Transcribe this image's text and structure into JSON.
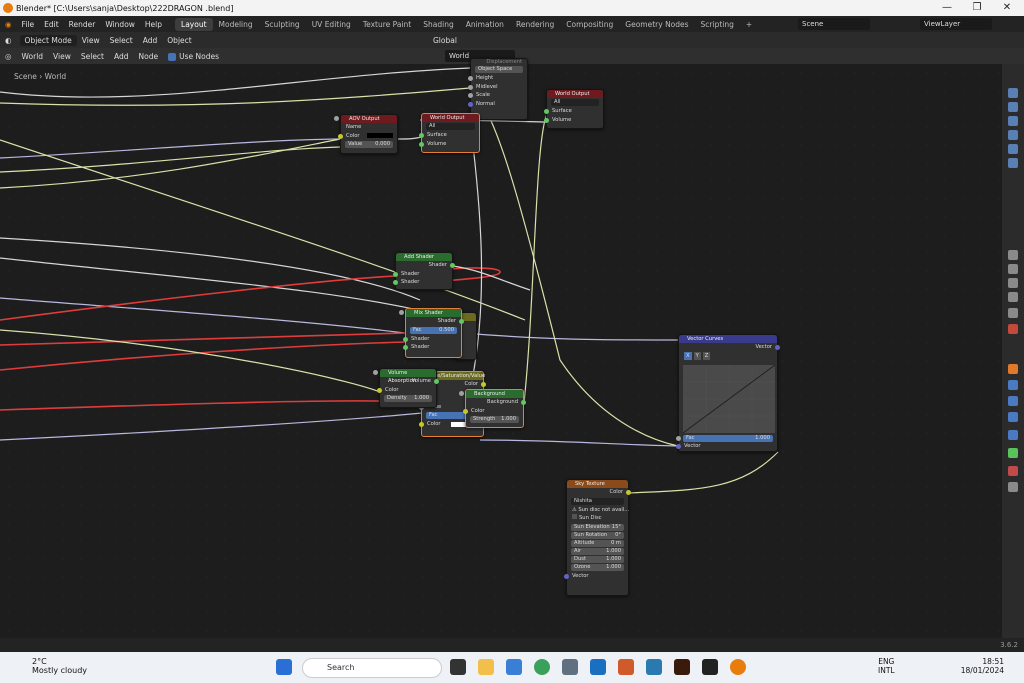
{
  "window": {
    "title": "Blender* [C:\\Users\\sanja\\Desktop\\222DRAGON .blend]",
    "minimize": "—",
    "maximize": "❐",
    "close": "✕"
  },
  "topbar": {
    "menus": [
      "File",
      "Edit",
      "Render",
      "Window",
      "Help"
    ],
    "workspaces": [
      "Layout",
      "Modeling",
      "Sculpting",
      "UV Editing",
      "Texture Paint",
      "Shading",
      "Animation",
      "Rendering",
      "Compositing",
      "Geometry Nodes",
      "Scripting"
    ],
    "add_tab": "+",
    "scene": "Scene",
    "view_layer": "ViewLayer"
  },
  "header2": {
    "mode": "Object Mode",
    "menus": [
      "View",
      "Select",
      "Add",
      "Object"
    ],
    "orientation": "Global"
  },
  "header3": {
    "shader_type": "World",
    "menus": [
      "View",
      "Select",
      "Add",
      "Node"
    ],
    "use_nodes": "Use Nodes",
    "world_name": "World"
  },
  "breadcrumb": {
    "scene": "Scene",
    "world": "World"
  },
  "nodes": {
    "aov": {
      "title": "AOV Output",
      "name_label": "Name",
      "color": "Color",
      "value_label": "Value",
      "value": "0.000"
    },
    "world_output_a": {
      "title": "World Output",
      "target": "All",
      "surface": "Surface",
      "volume": "Volume"
    },
    "world_output_b": {
      "title": "World Output",
      "target": "All",
      "surface": "Surface",
      "volume": "Volume"
    },
    "displacement": {
      "title": "Displacement",
      "space": "Object Space",
      "height": "Height",
      "midlevel": "Midlevel",
      "scale": "Scale",
      "normal": "Normal"
    },
    "add_shader": {
      "title": "Add Shader",
      "out": "Shader",
      "in1": "Shader",
      "in2": "Shader"
    },
    "mix_shader": {
      "title": "Mix Shader",
      "out": "Shader",
      "fac": "Fac",
      "fac_value": "0.500",
      "in1": "Shader",
      "in2": "Shader"
    },
    "volume_abs": {
      "title": "Volume Absorption",
      "out": "Volume",
      "color": "Color",
      "density": "Density",
      "density_value": "1.000"
    },
    "hue_sat": {
      "title": "Hue/Saturation/Value",
      "out": "Color",
      "value": "Value",
      "fac": "Fac",
      "color": "Color"
    },
    "background": {
      "title": "Background",
      "out": "Background",
      "color": "Color",
      "strength": "Strength",
      "strength_value": "1.000"
    },
    "vector_curves": {
      "title": "Vector Curves",
      "out": "Vector",
      "x": "X",
      "y": "Y",
      "z": "Z",
      "fac": "Fac",
      "fac_value": "1.000",
      "vector": "Vector"
    },
    "sky": {
      "title": "Sky Texture",
      "out": "Color",
      "type": "Nishita",
      "warning": "Sun disc not avail...",
      "sun_disc": "Sun Disc",
      "sun_elevation": "Sun Elevation",
      "sun_elevation_value": "15°",
      "sun_rotation": "Sun Rotation",
      "sun_rotation_value": "0°",
      "altitude": "Altitude",
      "altitude_value": "0 m",
      "air": "Air",
      "air_value": "1.000",
      "dust": "Dust",
      "dust_value": "1.000",
      "ozone": "Ozone",
      "ozone_value": "1.000",
      "vector": "Vector"
    }
  },
  "status": {
    "version": "3.6.2"
  },
  "taskbar": {
    "temp": "2°C",
    "weather": "Mostly cloudy",
    "search": "Search",
    "lang1": "ENG",
    "lang2": "INTL",
    "time": "18:51",
    "date": "18/01/2024"
  },
  "colors": {
    "accent": "#4772b3",
    "selected": "#e3813b",
    "link_red": "#e03c3c",
    "link_white": "#d6d6d6",
    "link_yellow_green": "#d8e2a8"
  }
}
